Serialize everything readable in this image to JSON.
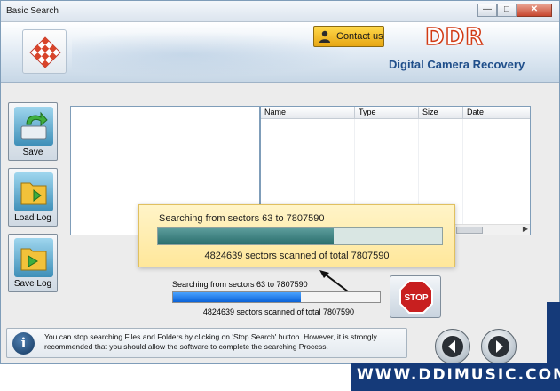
{
  "window": {
    "title": "Basic Search"
  },
  "window_controls": {
    "minimize": "—",
    "maximize": "□",
    "close": "✕"
  },
  "header": {
    "contact_label": "Contact us",
    "brand": "DDR",
    "product": "Digital Camera Recovery",
    "brand_color": "#d23a14",
    "product_color": "#1f4e8a"
  },
  "sidebar": {
    "items": [
      {
        "label": "Save",
        "icon": "save-drive-icon"
      },
      {
        "label": "Load Log",
        "icon": "folder-icon"
      },
      {
        "label": "Save Log",
        "icon": "folder-save-icon"
      }
    ]
  },
  "file_list": {
    "columns": [
      "Name",
      "Type",
      "Size",
      "Date"
    ]
  },
  "callout": {
    "search_text": "Searching from sectors 63 to 7807590",
    "progress": 0.62,
    "status_text": "4824639  sectors scanned of total 7807590"
  },
  "progress": {
    "search_text": "Searching from sectors 63 to 7807590",
    "value": 0.62,
    "status_text": "4824639  sectors scanned of total 7807590"
  },
  "stop_button": {
    "label": "STOP",
    "color": "#c81f1f"
  },
  "info": {
    "icon": "info-icon",
    "text": "You can stop searching Files and Folders by clicking on 'Stop Search' button. However, it is strongly recommended that you should allow the software to complete the searching Process."
  },
  "nav": {
    "back_icon": "back-arrow-icon",
    "next_icon": "next-arrow-icon"
  },
  "branding": {
    "website": "WWW.DDIMUSIC.COM",
    "strip_color": "#153a79"
  }
}
